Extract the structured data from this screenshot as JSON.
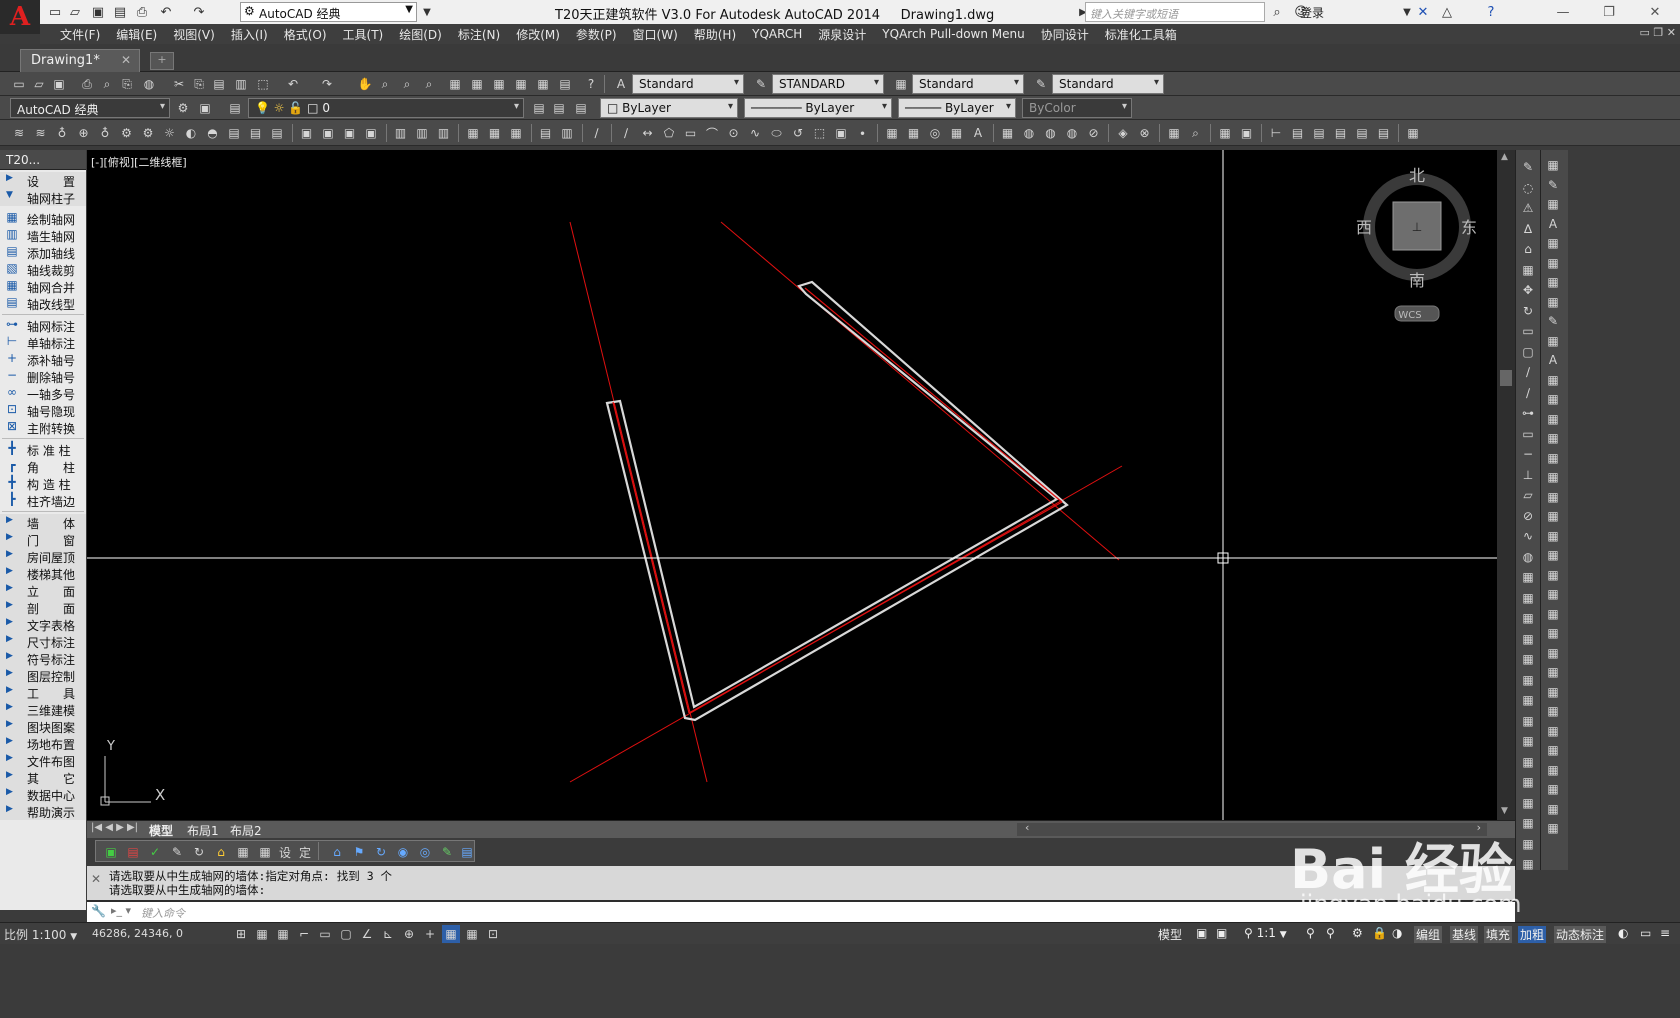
{
  "title": {
    "workspace": "AutoCAD 经典",
    "text": "T20天正建筑软件 V3.0 For Autodesk AutoCAD 2014     Drawing1.dwg",
    "search_placeholder": "键入关键字或短语",
    "login": "登录"
  },
  "menu": [
    "文件(F)",
    "编辑(E)",
    "视图(V)",
    "插入(I)",
    "格式(O)",
    "工具(T)",
    "绘图(D)",
    "标注(N)",
    "修改(M)",
    "参数(P)",
    "窗口(W)",
    "帮助(H)",
    "YQARCH",
    "源泉设计",
    "YQArch Pull-down Menu",
    "协同设计",
    "标准化工具箱"
  ],
  "doc_tab": "Drawing1*",
  "styles": {
    "text_style": "Standard",
    "dim_style": "STANDARD",
    "table_style": "Standard",
    "multileader_style": "Standard"
  },
  "layers": {
    "workspace": "AutoCAD 经典",
    "current_layer": "0",
    "color": "ByLayer",
    "linetype": "ByLayer",
    "lineweight": "ByLayer",
    "plotstyle": "ByColor"
  },
  "left_panel": {
    "header": "T20...",
    "sections": [
      {
        "label": "设　　置",
        "expanded": false
      },
      {
        "label": "轴网柱子",
        "expanded": true
      }
    ],
    "axis_items": [
      "绘制轴网",
      "墙生轴网",
      "添加轴线",
      "轴线裁剪",
      "轴网合并",
      "轴改线型"
    ],
    "axis_label_items": [
      "轴网标注",
      "单轴标注",
      "添补轴号",
      "删除轴号",
      "一轴多号",
      "轴号隐现",
      "主附转换"
    ],
    "column_items": [
      "标 准 柱",
      "角　　柱",
      "构 造 柱",
      "柱齐墙边"
    ],
    "more_sections": [
      "墙　　体",
      "门　　窗",
      "房间屋顶",
      "楼梯其他",
      "立　　面",
      "剖　　面",
      "文字表格",
      "尺寸标注",
      "符号标注",
      "图层控制",
      "工　　具",
      "三维建模",
      "图块图案",
      "场地布置",
      "文件布图",
      "其　　它",
      "数据中心",
      "帮助演示"
    ]
  },
  "canvas": {
    "viewport_label": "[-][俯视][二维线框]",
    "compass": {
      "north": "北",
      "south": "南",
      "east": "东",
      "west": "西",
      "wcs": "WCS"
    },
    "ucs": {
      "y": "Y",
      "x": "X"
    }
  },
  "layout_tabs": [
    "模型",
    "布局1",
    "布局2"
  ],
  "bottom_tools": {
    "t1": "设",
    "t2": "定"
  },
  "command": {
    "history": [
      "请选取要从中生成轴网的墙体:指定对角点: 找到 3 个",
      "请选取要从中生成轴网的墙体:"
    ],
    "input_placeholder": "键入命令"
  },
  "status": {
    "scale": "比例 1:100",
    "coords": "46286, 24346, 0",
    "model": "模型",
    "annotation_scale": "1:1",
    "tags": [
      "编组",
      "基线",
      "填充",
      "加粗",
      "动态标注"
    ]
  },
  "watermark": {
    "brand": "Bai 经验",
    "url": "jingyan.baidu.com"
  },
  "colors": {
    "axis_line": "#e01010",
    "wall": "#d8d8d8",
    "crosshair": "#ffffff",
    "canvas_bg": "#000000"
  }
}
